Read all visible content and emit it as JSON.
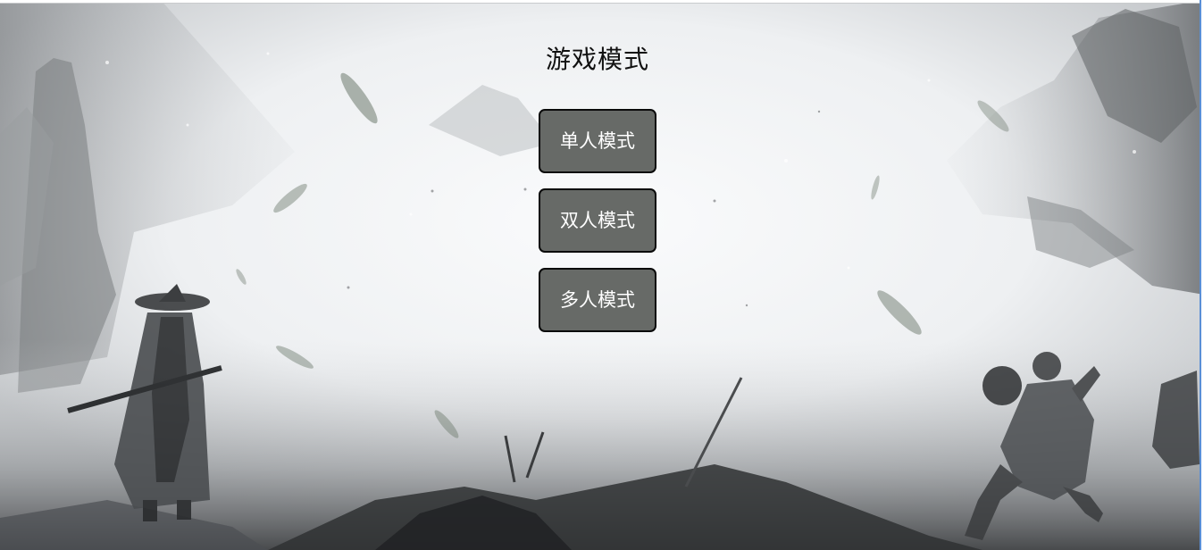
{
  "page": {
    "title": "游戏模式"
  },
  "menu": {
    "buttons": [
      {
        "label": "单人模式"
      },
      {
        "label": "双人模式"
      },
      {
        "label": "多人模式"
      }
    ]
  },
  "colors": {
    "button_bg": "#676a67",
    "button_border": "#0a0a0a",
    "button_text": "#ffffff",
    "title_text": "#111111",
    "background": "#eef0f1"
  },
  "background_art": "ink-wash-wuxia-battle-scene"
}
